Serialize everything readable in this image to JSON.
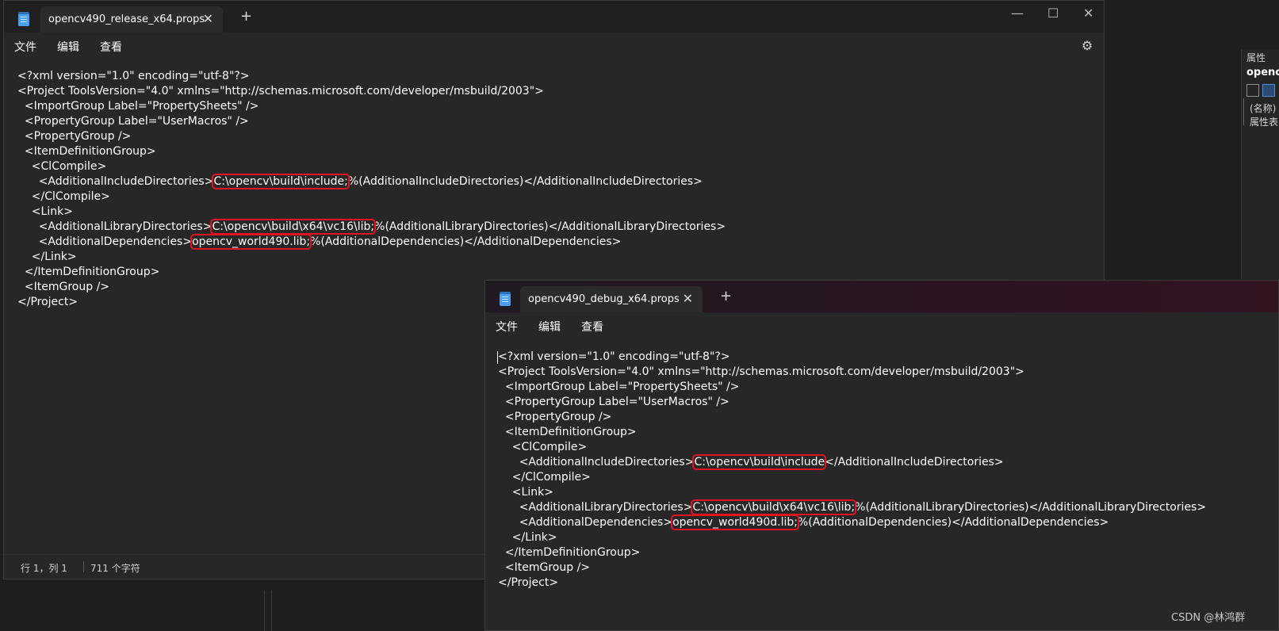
{
  "release_window": {
    "tab_title": "opencv490_release_x64.props",
    "tab_close": "✕",
    "tab_add": "+",
    "controls": {
      "minimize": "—",
      "maximize": "☐",
      "close": "✕"
    },
    "menu": {
      "file": "文件",
      "edit": "编辑",
      "view": "查看"
    },
    "settings_icon": "⚙",
    "lines": {
      "l1": "<?xml version=\"1.0\" encoding=\"utf-8\"?>",
      "l2": "<Project ToolsVersion=\"4.0\" xmlns=\"http://schemas.microsoft.com/developer/msbuild/2003\">",
      "l3": "  <ImportGroup Label=\"PropertySheets\" />",
      "l4": "  <PropertyGroup Label=\"UserMacros\" />",
      "l5": "  <PropertyGroup />",
      "l6": "  <ItemDefinitionGroup>",
      "l7": "    <ClCompile>",
      "l8_pre": "      <AdditionalIncludeDirectories>",
      "l8_hl": "C:\\opencv\\build\\include;",
      "l8_post": "%(AdditionalIncludeDirectories)</AdditionalIncludeDirectories>",
      "l9": "    </ClCompile>",
      "l10": "    <Link>",
      "l11_pre": "      <AdditionalLibraryDirectories>",
      "l11_hl": "C:\\opencv\\build\\x64\\vc16\\lib;",
      "l11_post": "%(AdditionalLibraryDirectories)</AdditionalLibraryDirectories>",
      "l12_pre": "      <AdditionalDependencies>",
      "l12_hl": "opencv_world490.lib;",
      "l12_post": "%(AdditionalDependencies)</AdditionalDependencies>",
      "l13": "    </Link>",
      "l14": "  </ItemDefinitionGroup>",
      "l15": "  <ItemGroup />",
      "l16": "</Project>"
    },
    "status": {
      "position": "行 1，列 1",
      "chars": "711 个字符"
    }
  },
  "debug_window": {
    "tab_title": "opencv490_debug_x64.props",
    "tab_close": "✕",
    "tab_add": "+",
    "menu": {
      "file": "文件",
      "edit": "编辑",
      "view": "查看"
    },
    "lines": {
      "l1": "<?xml version=\"1.0\" encoding=\"utf-8\"?>",
      "l2": "<Project ToolsVersion=\"4.0\" xmlns=\"http://schemas.microsoft.com/developer/msbuild/2003\">",
      "l3": "  <ImportGroup Label=\"PropertySheets\" />",
      "l4": "  <PropertyGroup Label=\"UserMacros\" />",
      "l5": "  <PropertyGroup />",
      "l6": "  <ItemDefinitionGroup>",
      "l7": "    <ClCompile>",
      "l8_pre": "      <AdditionalIncludeDirectories>",
      "l8_hl": "C:\\opencv\\build\\include",
      "l8_post": "</AdditionalIncludeDirectories>",
      "l9": "    </ClCompile>",
      "l10": "    <Link>",
      "l11_pre": "      <AdditionalLibraryDirectories>",
      "l11_hl": "C:\\opencv\\build\\x64\\vc16\\lib;",
      "l11_post": "%(AdditionalLibraryDirectories)</AdditionalLibraryDirectories>",
      "l12_pre": "      <AdditionalDependencies>",
      "l12_hl": "opencv_world490d.lib;",
      "l12_post": "%(AdditionalDependencies)</AdditionalDependencies>",
      "l13": "    </Link>",
      "l14": "  </ItemDefinitionGroup>",
      "l15": "  <ItemGroup />",
      "l16": "</Project>"
    }
  },
  "properties_panel": {
    "title": "属性",
    "name": "opencv",
    "row1": "(名称)",
    "row2": "属性表"
  },
  "watermark": "CSDN @林鸿群",
  "colors": {
    "highlight": "#e0141f",
    "editor_bg": "#272727",
    "text": "#ffffff"
  }
}
